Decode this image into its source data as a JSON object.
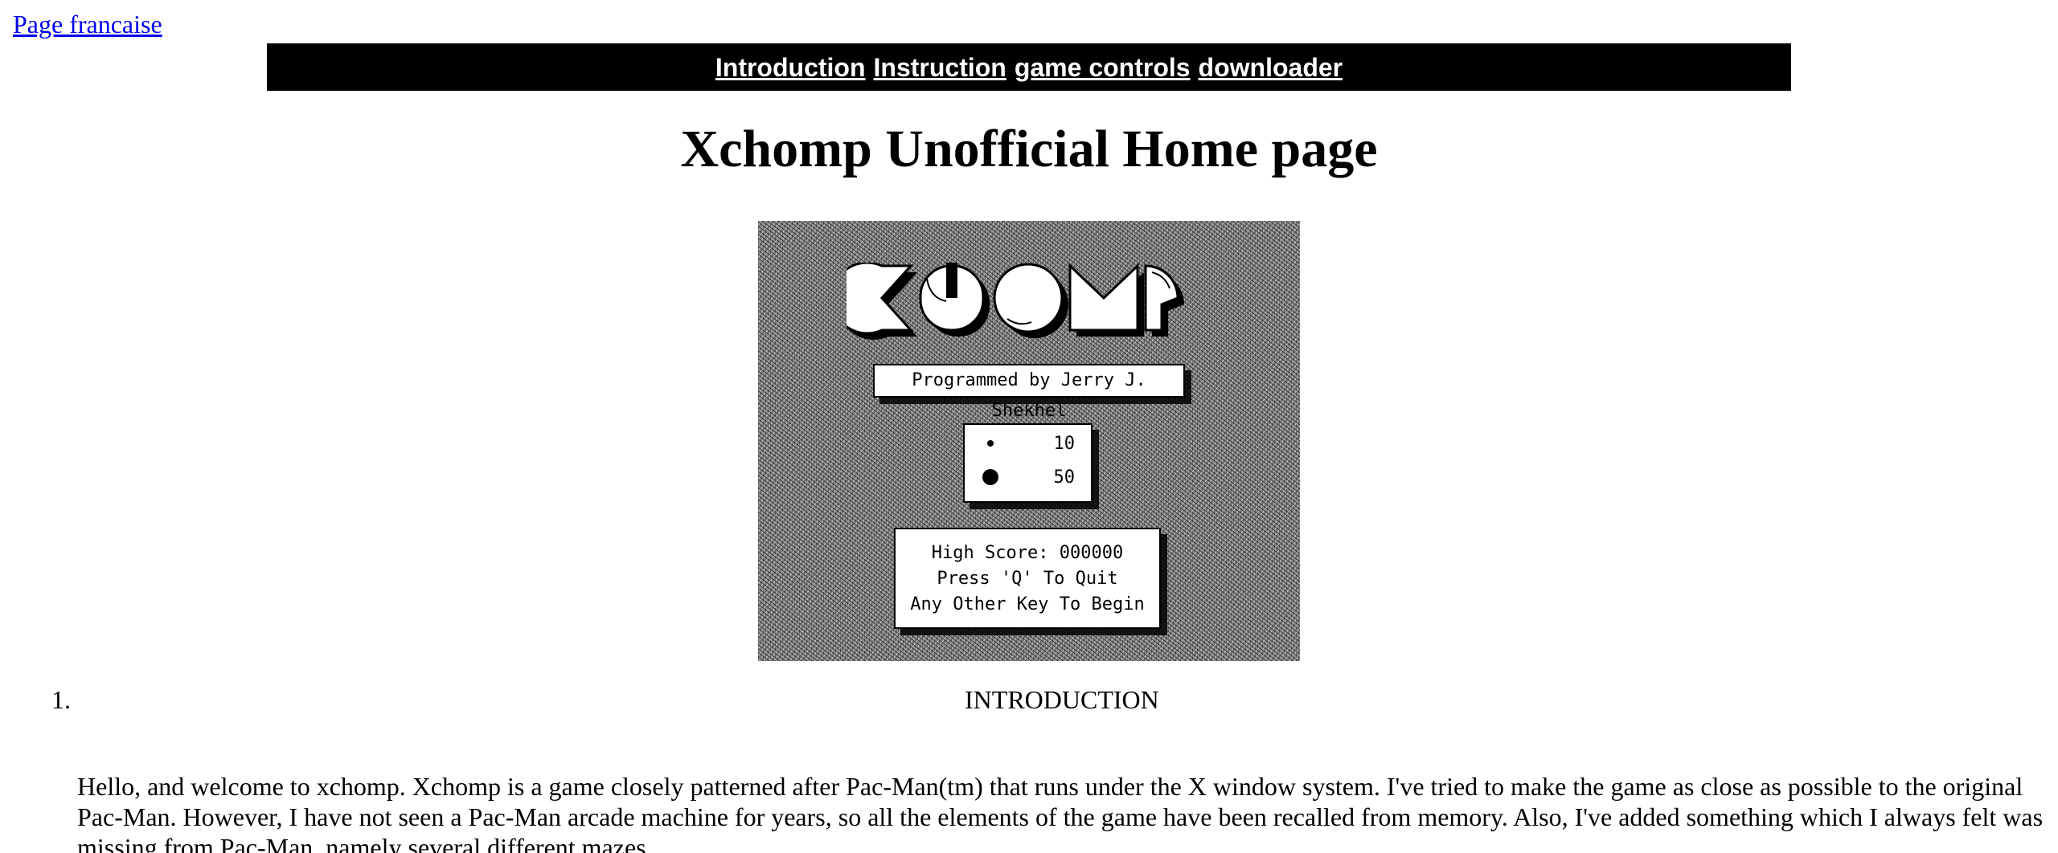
{
  "nav": {
    "lang_link": "Page francaise",
    "items": [
      "Introduction",
      "Instruction",
      "game controls",
      "downloader"
    ]
  },
  "page": {
    "title": "Xchomp Unofficial Home page"
  },
  "game_screen": {
    "logo_text": "CHOMP",
    "credit": "Programmed by Jerry J. Shekhel",
    "scores": [
      {
        "icon": "small-pellet-icon",
        "points": "10"
      },
      {
        "icon": "power-pellet-icon",
        "points": "50"
      }
    ],
    "high_score": "High Score: 000000",
    "quit_hint": "Press 'Q' To Quit",
    "begin_hint": "Any Other Key To Begin"
  },
  "section": {
    "number": "1.",
    "heading": "INTRODUCTION",
    "text": "Hello, and welcome to xchomp. Xchomp is a game closely patterned after Pac-Man(tm) that runs under the X window system. I've tried to make the game as close as possible to the original Pac-Man. However, I have not seen a Pac-Man arcade machine for years, so all the elements of the game have been recalled from memory. Also, I've added something which I always felt was missing from Pac-Man, namely several different mazes."
  }
}
